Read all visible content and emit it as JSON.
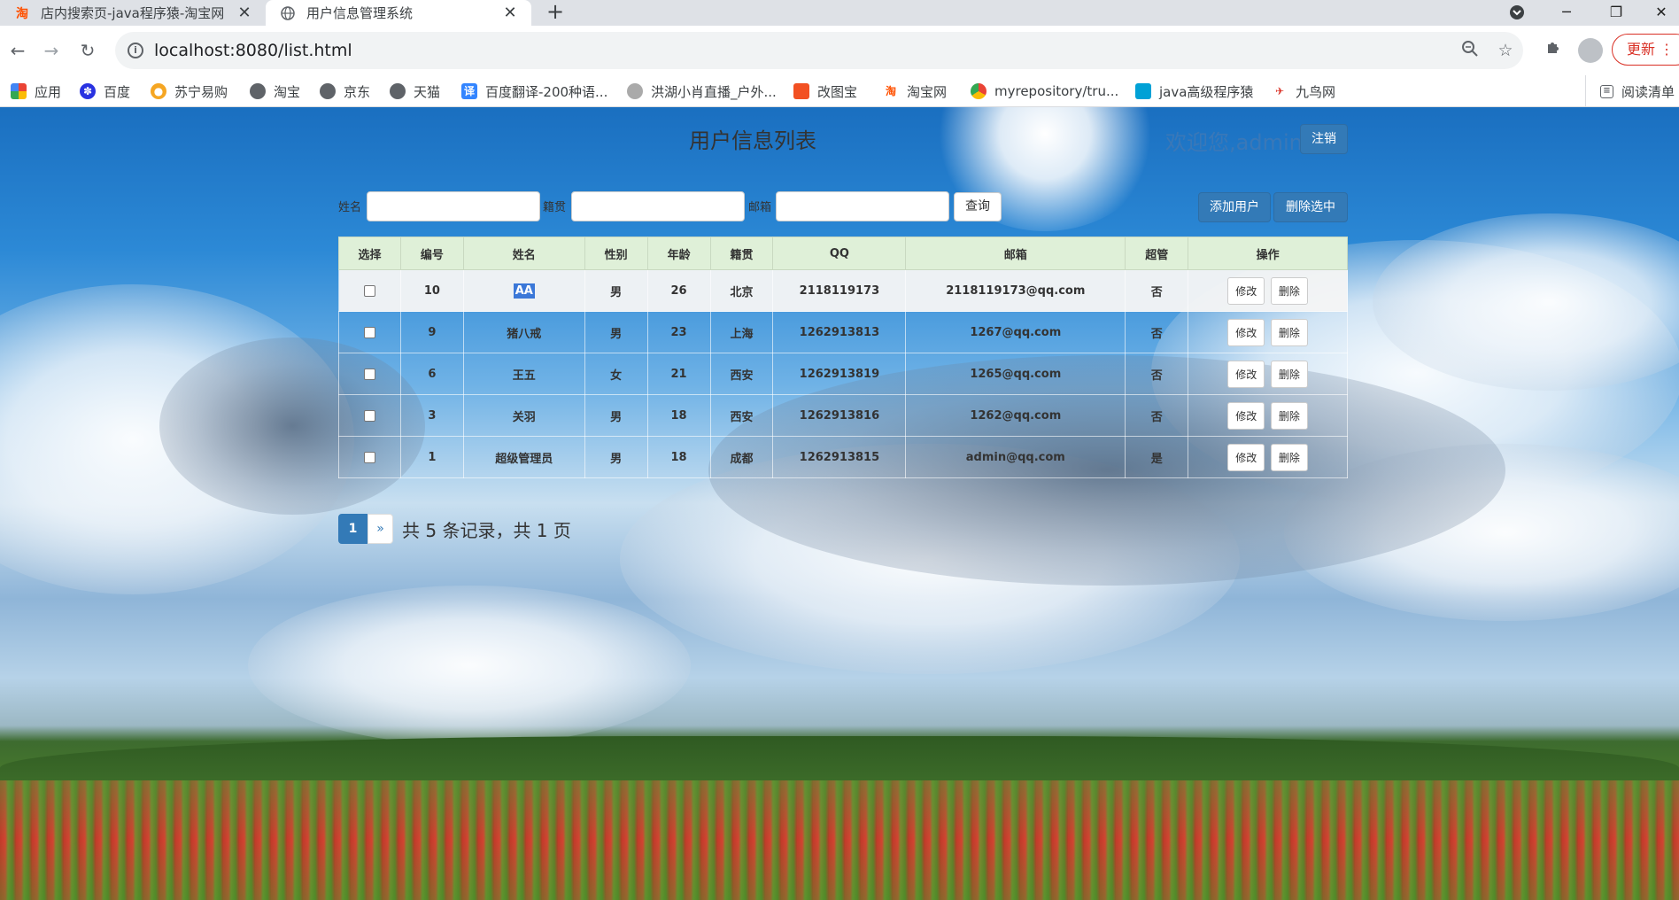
{
  "browser": {
    "tabs": [
      {
        "title": "店内搜索页-java程序猿-淘宝网",
        "favicon": "淘"
      },
      {
        "title": "用户信息管理系统",
        "favicon": "globe"
      }
    ],
    "url": "localhost:8080/list.html",
    "update_label": "更新",
    "bookmarks": [
      {
        "label": "应用",
        "icon": "apps-grid-icon",
        "color": "#e8453c"
      },
      {
        "label": "百度",
        "icon": "baidu-icon",
        "color": "#2932e1"
      },
      {
        "label": "苏宁易购",
        "icon": "suning-icon",
        "color": "#f5a623"
      },
      {
        "label": "淘宝",
        "icon": "globe-icon",
        "color": "#5f6368"
      },
      {
        "label": "京东",
        "icon": "globe-icon",
        "color": "#5f6368"
      },
      {
        "label": "天猫",
        "icon": "globe-icon",
        "color": "#5f6368"
      },
      {
        "label": "百度翻译-200种语...",
        "icon": "translate-icon",
        "color": "#3385ff"
      },
      {
        "label": "洪湖小肖直播_户外...",
        "icon": "live-icon",
        "color": "#888888"
      },
      {
        "label": "改图宝",
        "icon": "gaitubao-icon",
        "color": "#f25022"
      },
      {
        "label": "淘宝网",
        "icon": "taobao-icon",
        "color": "#ff5000"
      },
      {
        "label": "myrepository/tru...",
        "icon": "chrome-icon",
        "color": "#34a853"
      },
      {
        "label": "java高级程序猿",
        "icon": "bilibili-icon",
        "color": "#00a1d6"
      },
      {
        "label": "九鸟网",
        "icon": "bird-icon",
        "color": "#d93025"
      }
    ],
    "reading_list": "阅读清单"
  },
  "page": {
    "title": "用户信息列表",
    "welcome": "欢迎您,admin",
    "logout": "注销",
    "search": {
      "name_label": "姓名",
      "origin_label": "籍贯",
      "email_label": "邮箱",
      "name_value": "",
      "origin_value": "",
      "email_value": "",
      "query_label": "查询"
    },
    "add_user": "添加用户",
    "delete_selected": "删除选中",
    "table": {
      "headers": [
        "选择",
        "编号",
        "姓名",
        "性别",
        "年龄",
        "籍贯",
        "QQ",
        "邮箱",
        "超管",
        "操作"
      ],
      "edit_label": "修改",
      "delete_label": "删除",
      "rows": [
        {
          "id": "10",
          "name": "AA",
          "gender": "男",
          "age": "26",
          "origin": "北京",
          "qq": "2118119173",
          "email": "2118119173@qq.com",
          "admin": "否"
        },
        {
          "id": "9",
          "name": "猪八戒",
          "gender": "男",
          "age": "23",
          "origin": "上海",
          "qq": "1262913813",
          "email": "1267@qq.com",
          "admin": "否"
        },
        {
          "id": "6",
          "name": "王五",
          "gender": "女",
          "age": "21",
          "origin": "西安",
          "qq": "1262913819",
          "email": "1265@qq.com",
          "admin": "否"
        },
        {
          "id": "3",
          "name": "关羽",
          "gender": "男",
          "age": "18",
          "origin": "西安",
          "qq": "1262913816",
          "email": "1262@qq.com",
          "admin": "否"
        },
        {
          "id": "1",
          "name": "超级管理员",
          "gender": "男",
          "age": "18",
          "origin": "成都",
          "qq": "1262913815",
          "email": "admin@qq.com",
          "admin": "是"
        }
      ]
    },
    "pagination": {
      "current": "1",
      "next": "»",
      "info": "共 5 条记录，共 1 页"
    }
  }
}
